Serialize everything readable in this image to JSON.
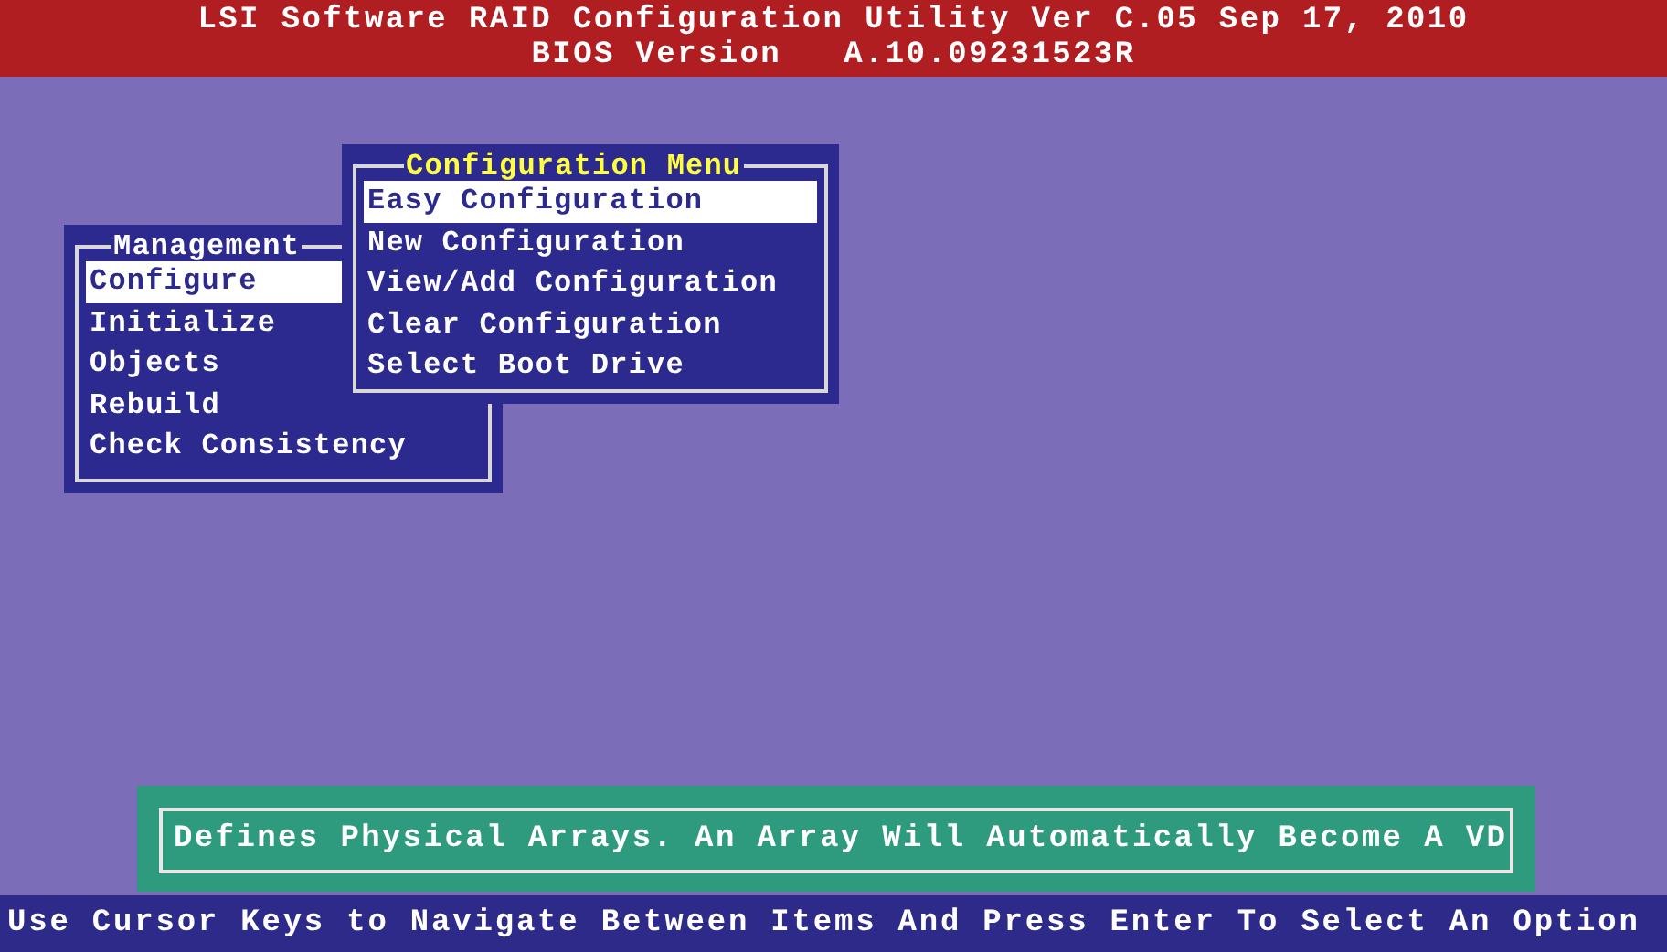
{
  "header": {
    "title": "LSI Software RAID Configuration Utility Ver C.05 Sep 17, 2010",
    "bios_label": "BIOS Version",
    "bios_version": "A.10.09231523R"
  },
  "management_menu": {
    "title": "Management",
    "items": [
      {
        "label": "Configure",
        "selected": true
      },
      {
        "label": "Initialize",
        "selected": false
      },
      {
        "label": "Objects",
        "selected": false
      },
      {
        "label": "Rebuild",
        "selected": false
      },
      {
        "label": "Check Consistency",
        "selected": false
      }
    ]
  },
  "configuration_menu": {
    "title": "Configuration Menu",
    "items": [
      {
        "label": "Easy Configuration",
        "selected": true
      },
      {
        "label": "New Configuration",
        "selected": false
      },
      {
        "label": "View/Add Configuration",
        "selected": false
      },
      {
        "label": "Clear Configuration",
        "selected": false
      },
      {
        "label": "Select Boot Drive",
        "selected": false
      }
    ]
  },
  "hint": "Defines Physical Arrays. An Array Will Automatically Become A VD",
  "status_bar": "Use Cursor Keys to Navigate Between Items And Press Enter To Select An Option"
}
